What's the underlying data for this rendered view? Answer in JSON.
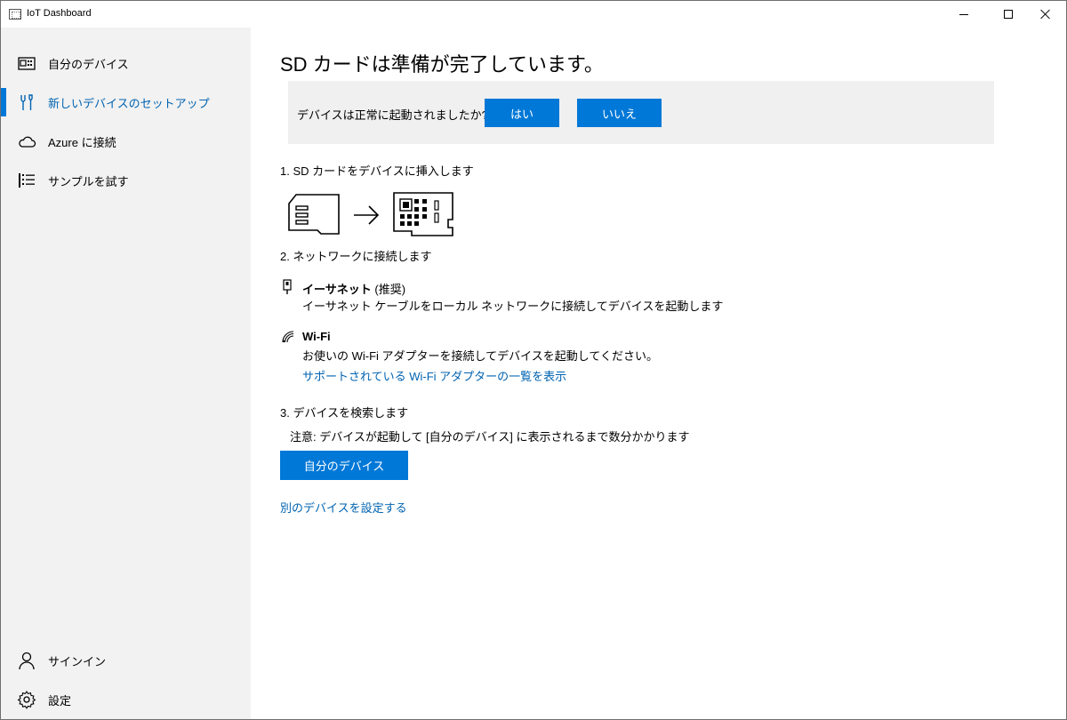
{
  "window": {
    "title": "IoT Dashboard"
  },
  "sidebar": {
    "items": [
      {
        "label": "自分のデバイス",
        "icon": "device-icon"
      },
      {
        "label": "新しいデバイスのセットアップ",
        "icon": "tools-icon"
      },
      {
        "label": "Azure に接続",
        "icon": "cloud-icon"
      },
      {
        "label": "サンプルを試す",
        "icon": "list-icon"
      }
    ],
    "bottom": [
      {
        "label": "サインイン",
        "icon": "person-icon"
      },
      {
        "label": "設定",
        "icon": "gear-icon"
      }
    ]
  },
  "main": {
    "title": "SD カードは準備が完了しています。",
    "question": {
      "text": "デバイスは正常に起動されましたか?",
      "yes_label": "はい",
      "no_label": "いいえ"
    },
    "step1": "1. SD カードをデバイスに挿入します",
    "step2": "2. ネットワークに接続します",
    "ethernet": {
      "title": "イーサネット",
      "recommended": "(推奨)",
      "desc": "イーサネット ケーブルをローカル ネットワークに接続してデバイスを起動します"
    },
    "wifi": {
      "title": "Wi-Fi",
      "desc": "お使いの Wi-Fi アダプターを接続してデバイスを起動してください。",
      "link": "サポートされている Wi-Fi アダプターの一覧を表示"
    },
    "step3": "3. デバイスを検索します",
    "note": "注意: デバイスが起動して [自分のデバイス] に表示されるまで数分かかります",
    "my_devices_button": "自分のデバイス",
    "other_device_link": "別のデバイスを設定する"
  },
  "colors": {
    "accent": "#0078d7",
    "link": "#0063b1",
    "sidebar_bg": "#f2f2f2",
    "panel_bg": "#f0f0f0"
  }
}
